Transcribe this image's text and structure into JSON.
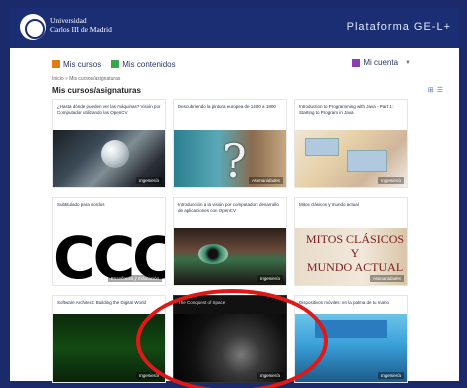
{
  "header": {
    "university_line1": "Universidad",
    "university_line2": "Carlos III de Madrid",
    "platform": "Plataforma GE-L+"
  },
  "nav": {
    "courses": "Mis cursos",
    "contents": "Mis contenidos",
    "account": "Mi cuenta"
  },
  "breadcrumb": "Inicio  »  Mis cursos/asignaturas",
  "section_title": "Mis cursos/asignaturas",
  "view_icons": {
    "grid": "⊞",
    "list": "☰"
  },
  "cards": [
    {
      "title": "¿Hasta dónde pueden ver las máquinas? Visión por Computador utilizando las OpenCV",
      "tag": "Ingeniería"
    },
    {
      "title": "Descubriendo la pintura europea de 1400 a 1800",
      "tag": "Humanidades"
    },
    {
      "title": "Introduction to Programming with Java - Part 1: Starting to Program in Java",
      "tag": "Ingeniería"
    },
    {
      "title": "Subtitulado para sordos",
      "tag": "Enseñanza y Educación"
    },
    {
      "title": "Introducción a la visión por computador: desarrollo de aplicaciones con OpenCV",
      "tag": "Ingeniería"
    },
    {
      "title": "Mitos clásicos y mundo actual",
      "tag": "Humanidades"
    },
    {
      "title": "Software Architect: Building the Digital World",
      "tag": "Ingeniería"
    },
    {
      "title": "The Conquest of Space",
      "tag": "Ingeniería"
    },
    {
      "title": "Dispositivos móviles: en la palma de tu mano",
      "tag": "Ingeniería"
    }
  ],
  "card_images": {
    "ccc_text": "CCC",
    "mitos_line1": "MITOS CLÁSICOS",
    "mitos_line2": "Y",
    "mitos_line3": "MUNDO ACTUAL"
  },
  "colors": {
    "frame": "#1a2a6b",
    "header": "#1c2e73",
    "annotation": "#e01818"
  }
}
